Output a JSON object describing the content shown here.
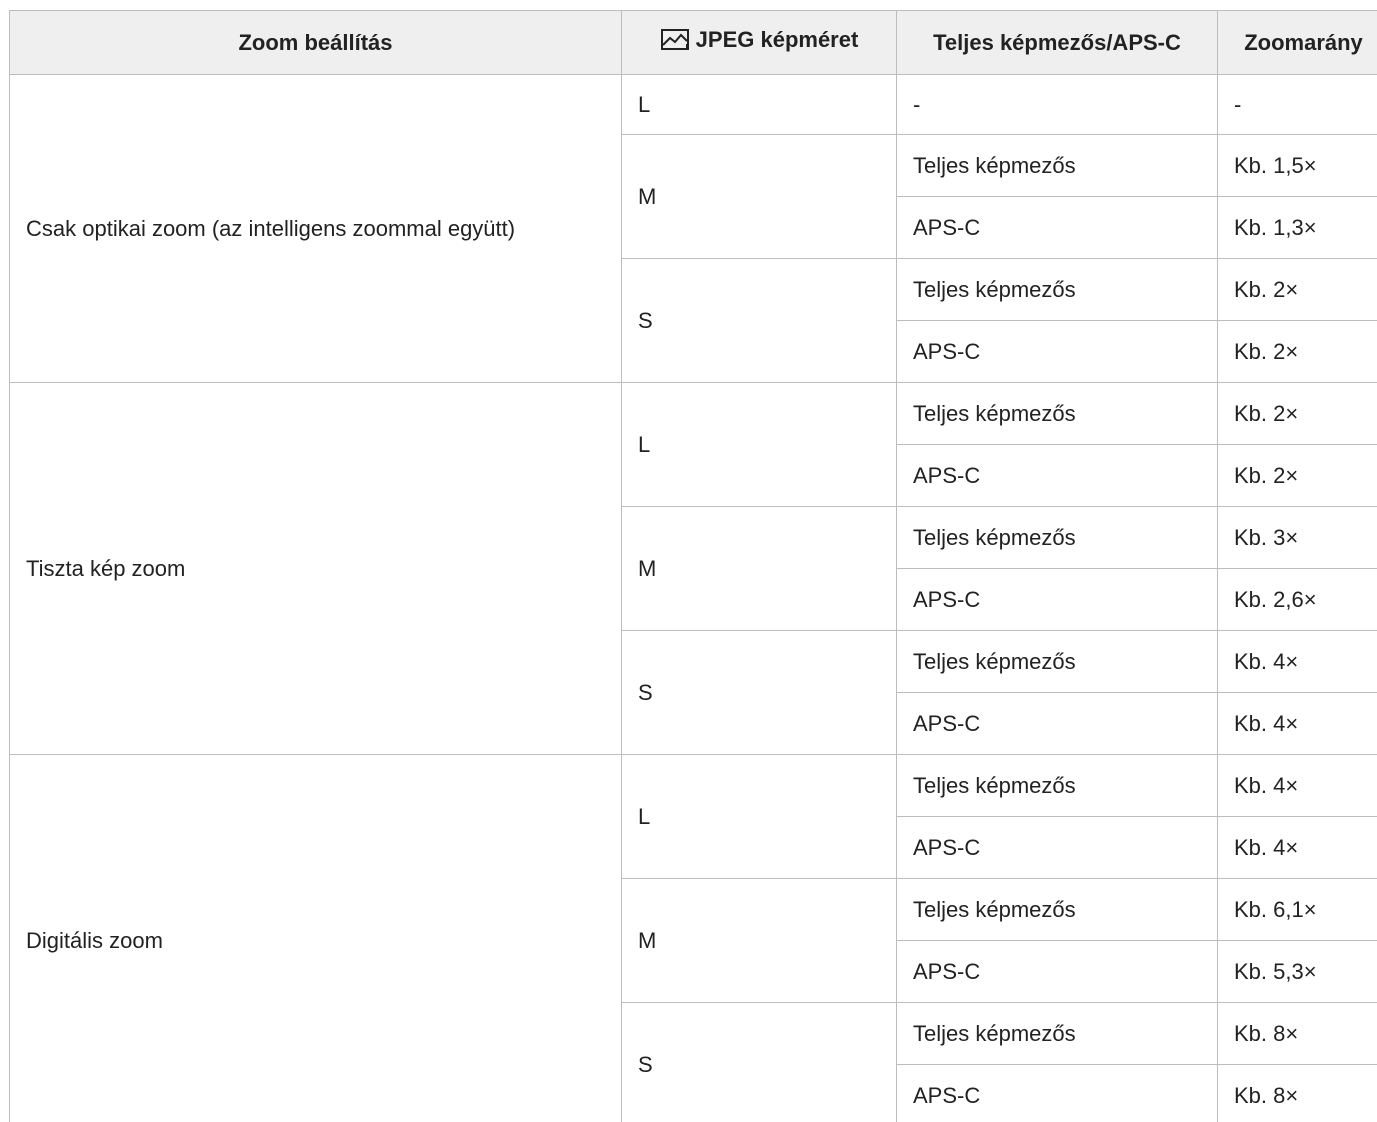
{
  "table": {
    "headers": {
      "setting": "Zoom beállítás",
      "image_size": "JPEG képméret",
      "image_size_icon": "jpeg-image-size-icon",
      "frame": "Teljes képmezős/APS-C",
      "ratio": "Zoomarány"
    },
    "groups": [
      {
        "setting": "Csak optikai zoom (az intelligens zoommal együtt)",
        "sizes": [
          {
            "size": "L",
            "rows": [
              {
                "frame": "-",
                "ratio": "-"
              }
            ]
          },
          {
            "size": "M",
            "rows": [
              {
                "frame": "Teljes képmezős",
                "ratio": "Kb. 1,5×"
              },
              {
                "frame": "APS-C",
                "ratio": "Kb. 1,3×"
              }
            ]
          },
          {
            "size": "S",
            "rows": [
              {
                "frame": "Teljes képmezős",
                "ratio": "Kb. 2×"
              },
              {
                "frame": "APS-C",
                "ratio": "Kb. 2×"
              }
            ]
          }
        ]
      },
      {
        "setting": "Tiszta kép zoom",
        "sizes": [
          {
            "size": "L",
            "rows": [
              {
                "frame": "Teljes képmezős",
                "ratio": "Kb. 2×"
              },
              {
                "frame": "APS-C",
                "ratio": "Kb. 2×"
              }
            ]
          },
          {
            "size": "M",
            "rows": [
              {
                "frame": "Teljes képmezős",
                "ratio": "Kb. 3×"
              },
              {
                "frame": "APS-C",
                "ratio": "Kb. 2,6×"
              }
            ]
          },
          {
            "size": "S",
            "rows": [
              {
                "frame": "Teljes képmezős",
                "ratio": "Kb. 4×"
              },
              {
                "frame": "APS-C",
                "ratio": "Kb. 4×"
              }
            ]
          }
        ]
      },
      {
        "setting": "Digitális zoom",
        "sizes": [
          {
            "size": "L",
            "rows": [
              {
                "frame": "Teljes képmezős",
                "ratio": "Kb. 4×"
              },
              {
                "frame": "APS-C",
                "ratio": "Kb. 4×"
              }
            ]
          },
          {
            "size": "M",
            "rows": [
              {
                "frame": "Teljes képmezős",
                "ratio": "Kb. 6,1×"
              },
              {
                "frame": "APS-C",
                "ratio": "Kb. 5,3×"
              }
            ]
          },
          {
            "size": "S",
            "rows": [
              {
                "frame": "Teljes képmezős",
                "ratio": "Kb. 8×"
              },
              {
                "frame": "APS-C",
                "ratio": "Kb. 8×"
              }
            ]
          }
        ]
      }
    ]
  }
}
